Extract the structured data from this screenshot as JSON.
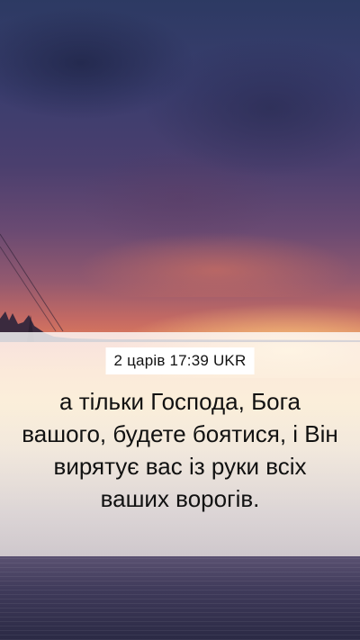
{
  "reference": "2 царів 17:39 UKR",
  "verse": "а тільки Господа, Бога вашого, будете боятися, і Він вирятує вас із руки всіх ваших ворогів.",
  "colors": {
    "text": "#111111",
    "pill_background": "#ffffff",
    "sky_top": "#2d3a63",
    "sunset_glow": "#f7c46a"
  }
}
